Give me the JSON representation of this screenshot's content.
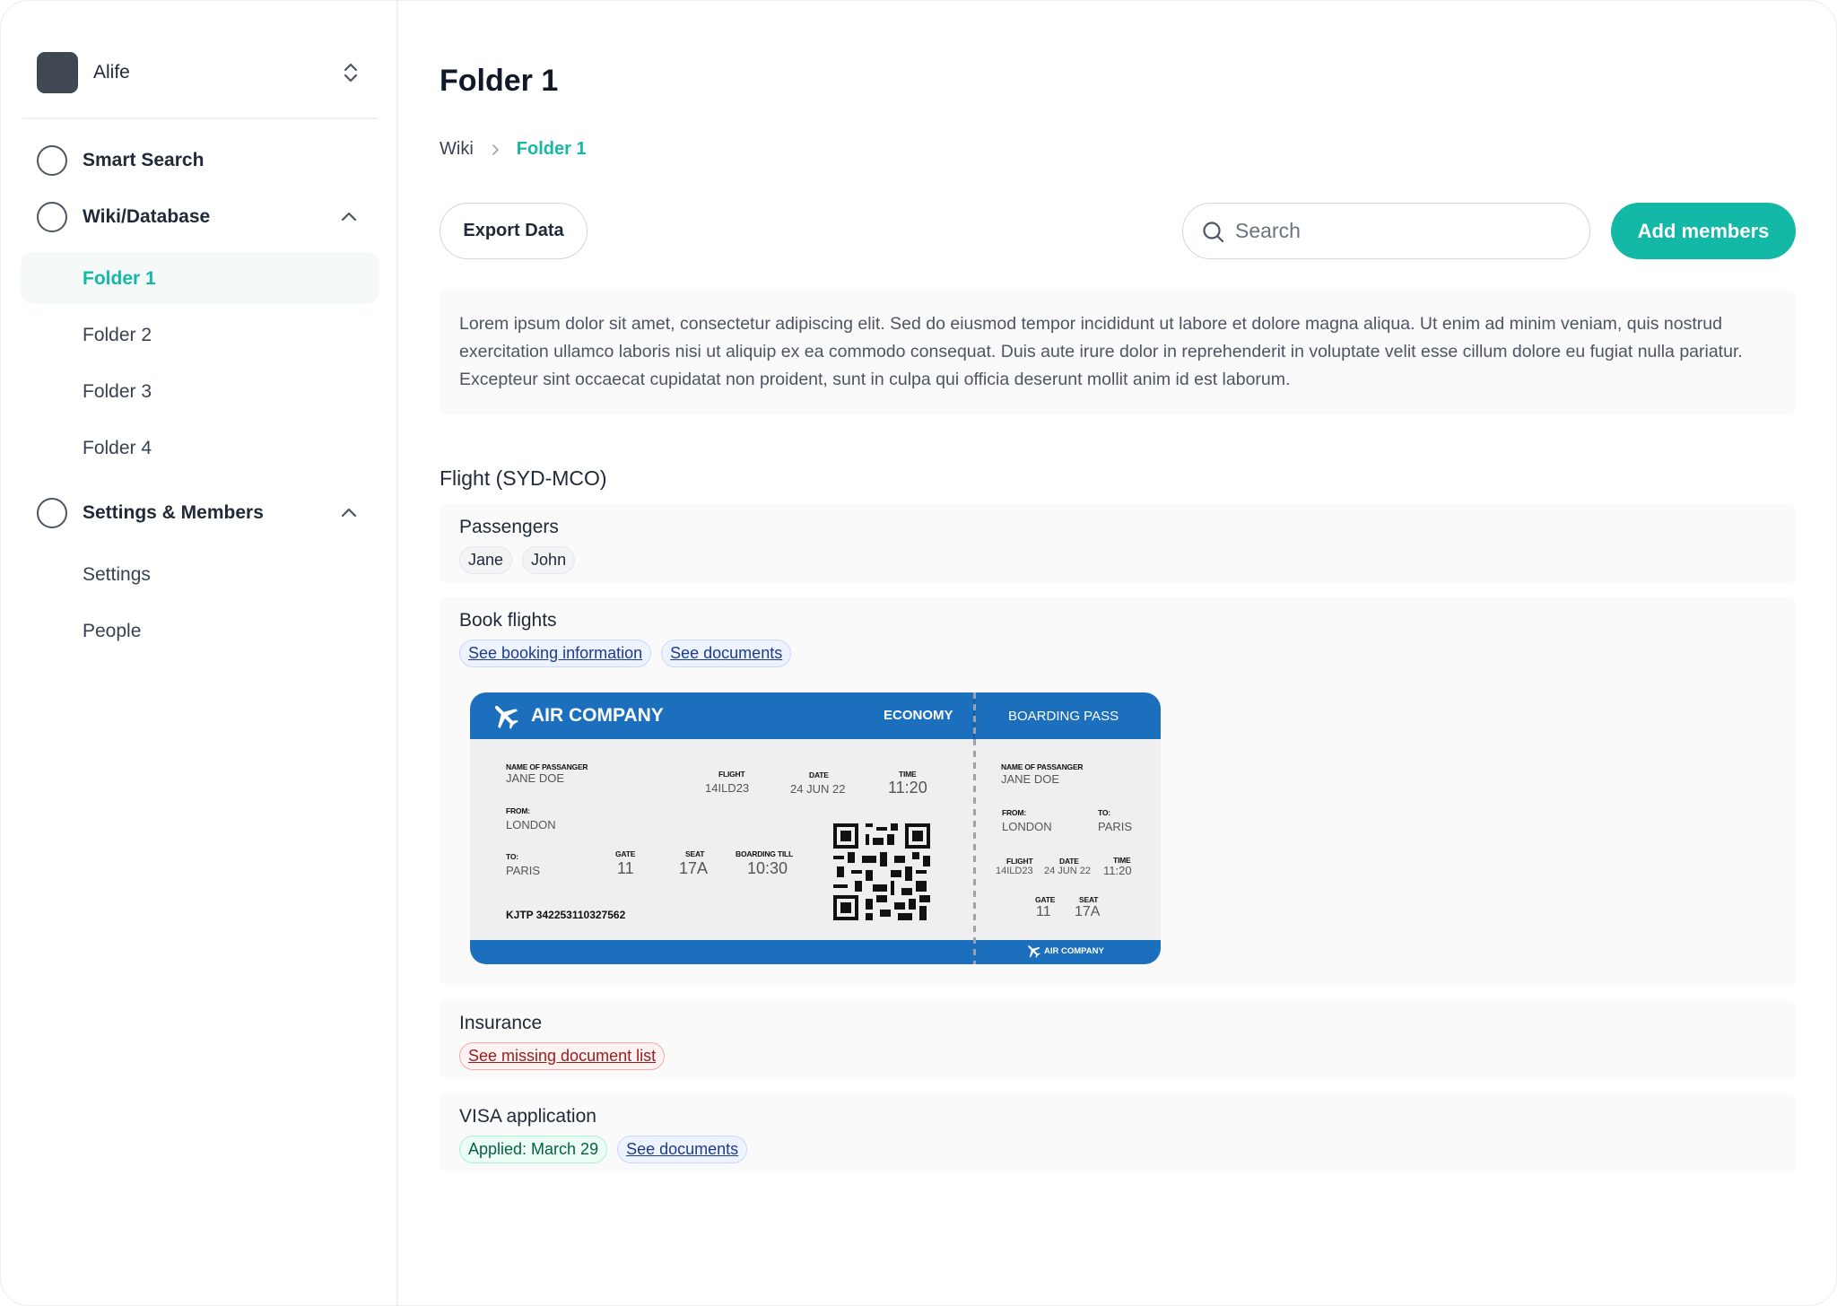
{
  "workspace": {
    "name": "Alife"
  },
  "sidebar": {
    "sections": [
      {
        "label": "Smart Search"
      },
      {
        "label": "Wiki/Database",
        "items": [
          "Folder 1",
          "Folder 2",
          "Folder 3",
          "Folder 4"
        ],
        "active": "Folder 1"
      },
      {
        "label": "Settings & Members",
        "items": [
          "Settings",
          "People"
        ]
      }
    ]
  },
  "page": {
    "title": "Folder 1",
    "breadcrumb": [
      "Wiki",
      "Folder 1"
    ]
  },
  "toolbar": {
    "export_label": "Export Data",
    "search_placeholder": "Search",
    "search_value": "",
    "add_label": "Add members"
  },
  "description": "Lorem ipsum dolor sit amet, consectetur adipiscing elit. Sed do eiusmod tempor incididunt ut labore et dolore magna aliqua. Ut enim ad minim veniam, quis nostrud exercitation ullamco laboris nisi ut aliquip ex ea commodo consequat. Duis aute irure dolor in reprehenderit in voluptate velit esse cillum dolore eu fugiat nulla pariatur. Excepteur sint occaecat cupidatat non proident, sunt in culpa qui officia deserunt mollit anim id est laborum.",
  "section_title": "Flight (SYD-MCO)",
  "cards": {
    "passengers": {
      "label": "Passengers",
      "tags": [
        "Jane",
        "John"
      ]
    },
    "book_flights": {
      "label": "Book flights",
      "links": [
        "See booking information",
        "See documents"
      ]
    },
    "insurance": {
      "label": "Insurance",
      "links": [
        "See missing document list"
      ]
    },
    "visa": {
      "label": "VISA application",
      "status": "Applied: March 29",
      "links": [
        "See documents"
      ]
    }
  },
  "boarding_pass": {
    "airline": "AIR COMPANY",
    "class": "ECONOMY",
    "pass_title": "BOARDING PASS",
    "labels": {
      "name": "NAME OF PASSANGER",
      "flight": "FLIGHT",
      "date": "DATE",
      "time": "TIME",
      "from": "FROM:",
      "to": "TO:",
      "gate": "GATE",
      "seat": "SEAT",
      "boarding_till": "BOARDING TILL"
    },
    "passenger": "JANE DOE",
    "flight": "14ILD23",
    "date": "24 JUN 22",
    "time": "11:20",
    "from": "LONDON",
    "to": "PARIS",
    "gate": "11",
    "seat": "17A",
    "boarding_till": "10:30",
    "ticket_number": "KJTP 342253110327562",
    "footer": "AIR COMPANY"
  },
  "colors": {
    "accent": "#14b8a6",
    "boarding_blue": "#1c6fbd"
  }
}
